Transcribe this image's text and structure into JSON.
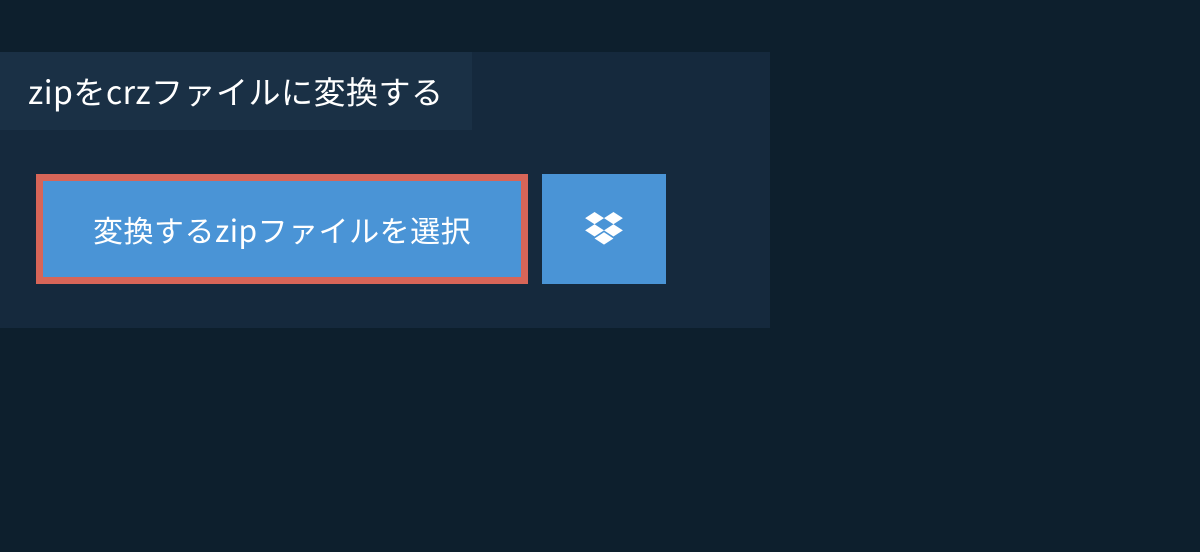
{
  "title": "zipをcrzファイルに変換する",
  "buttons": {
    "select_label": "変換するzipファイルを選択"
  }
}
